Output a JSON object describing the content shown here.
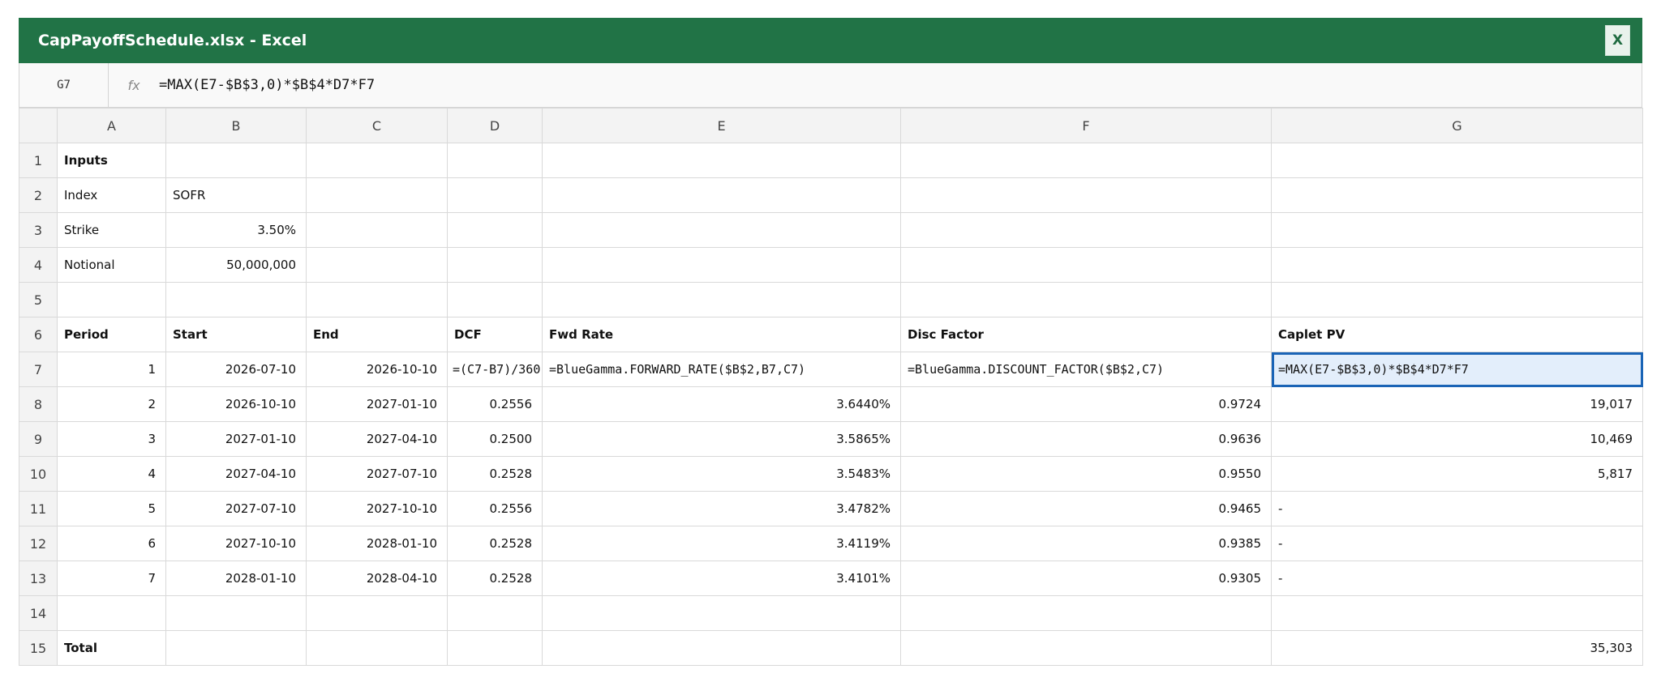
{
  "window": {
    "title": "CapPayoffSchedule.xlsx - Excel",
    "close_label": "X"
  },
  "formula_bar": {
    "name_box": "G7",
    "fx_label": "fx",
    "formula": "=MAX(E7-$B$3,0)*$B$4*D7*F7"
  },
  "columns": [
    "A",
    "B",
    "C",
    "D",
    "E",
    "F",
    "G"
  ],
  "rows": [
    {
      "n": "1",
      "cells": [
        "Inputs",
        "",
        "",
        "",
        "",
        "",
        ""
      ]
    },
    {
      "n": "2",
      "cells": [
        "Index",
        "SOFR",
        "",
        "",
        "",
        "",
        ""
      ]
    },
    {
      "n": "3",
      "cells": [
        "Strike",
        "3.50%",
        "",
        "",
        "",
        "",
        ""
      ]
    },
    {
      "n": "4",
      "cells": [
        "Notional",
        "50,000,000",
        "",
        "",
        "",
        "",
        ""
      ]
    },
    {
      "n": "5",
      "cells": [
        "",
        "",
        "",
        "",
        "",
        "",
        ""
      ]
    },
    {
      "n": "6",
      "cells": [
        "Period",
        "Start",
        "End",
        "DCF",
        "Fwd Rate",
        "Disc Factor",
        "Caplet PV"
      ]
    },
    {
      "n": "7",
      "cells": [
        "1",
        "2026-07-10",
        "2026-10-10",
        "=(C7-B7)/360",
        "=BlueGamma.FORWARD_RATE($B$2,B7,C7)",
        "=BlueGamma.DISCOUNT_FACTOR($B$2,C7)",
        "=MAX(E7-$B$3,0)*$B$4*D7*F7"
      ]
    },
    {
      "n": "8",
      "cells": [
        "2",
        "2026-10-10",
        "2027-01-10",
        "0.2556",
        "3.6440%",
        "0.9724",
        "19,017"
      ]
    },
    {
      "n": "9",
      "cells": [
        "3",
        "2027-01-10",
        "2027-04-10",
        "0.2500",
        "3.5865%",
        "0.9636",
        "10,469"
      ]
    },
    {
      "n": "10",
      "cells": [
        "4",
        "2027-04-10",
        "2027-07-10",
        "0.2528",
        "3.5483%",
        "0.9550",
        "5,817"
      ]
    },
    {
      "n": "11",
      "cells": [
        "5",
        "2027-07-10",
        "2027-10-10",
        "0.2556",
        "3.4782%",
        "0.9465",
        "-"
      ]
    },
    {
      "n": "12",
      "cells": [
        "6",
        "2027-10-10",
        "2028-01-10",
        "0.2528",
        "3.4119%",
        "0.9385",
        "-"
      ]
    },
    {
      "n": "13",
      "cells": [
        "7",
        "2028-01-10",
        "2028-04-10",
        "0.2528",
        "3.4101%",
        "0.9305",
        "-"
      ]
    },
    {
      "n": "14",
      "cells": [
        "",
        "",
        "",
        "",
        "",
        "",
        ""
      ]
    },
    {
      "n": "15",
      "cells": [
        "Total",
        "",
        "",
        "",
        "",
        "",
        "35,303"
      ]
    }
  ],
  "selected_cell": "G7",
  "colors": {
    "title_bar": "#217346",
    "selection_border": "#1a64b6",
    "selection_fill": "#e3eefb"
  }
}
